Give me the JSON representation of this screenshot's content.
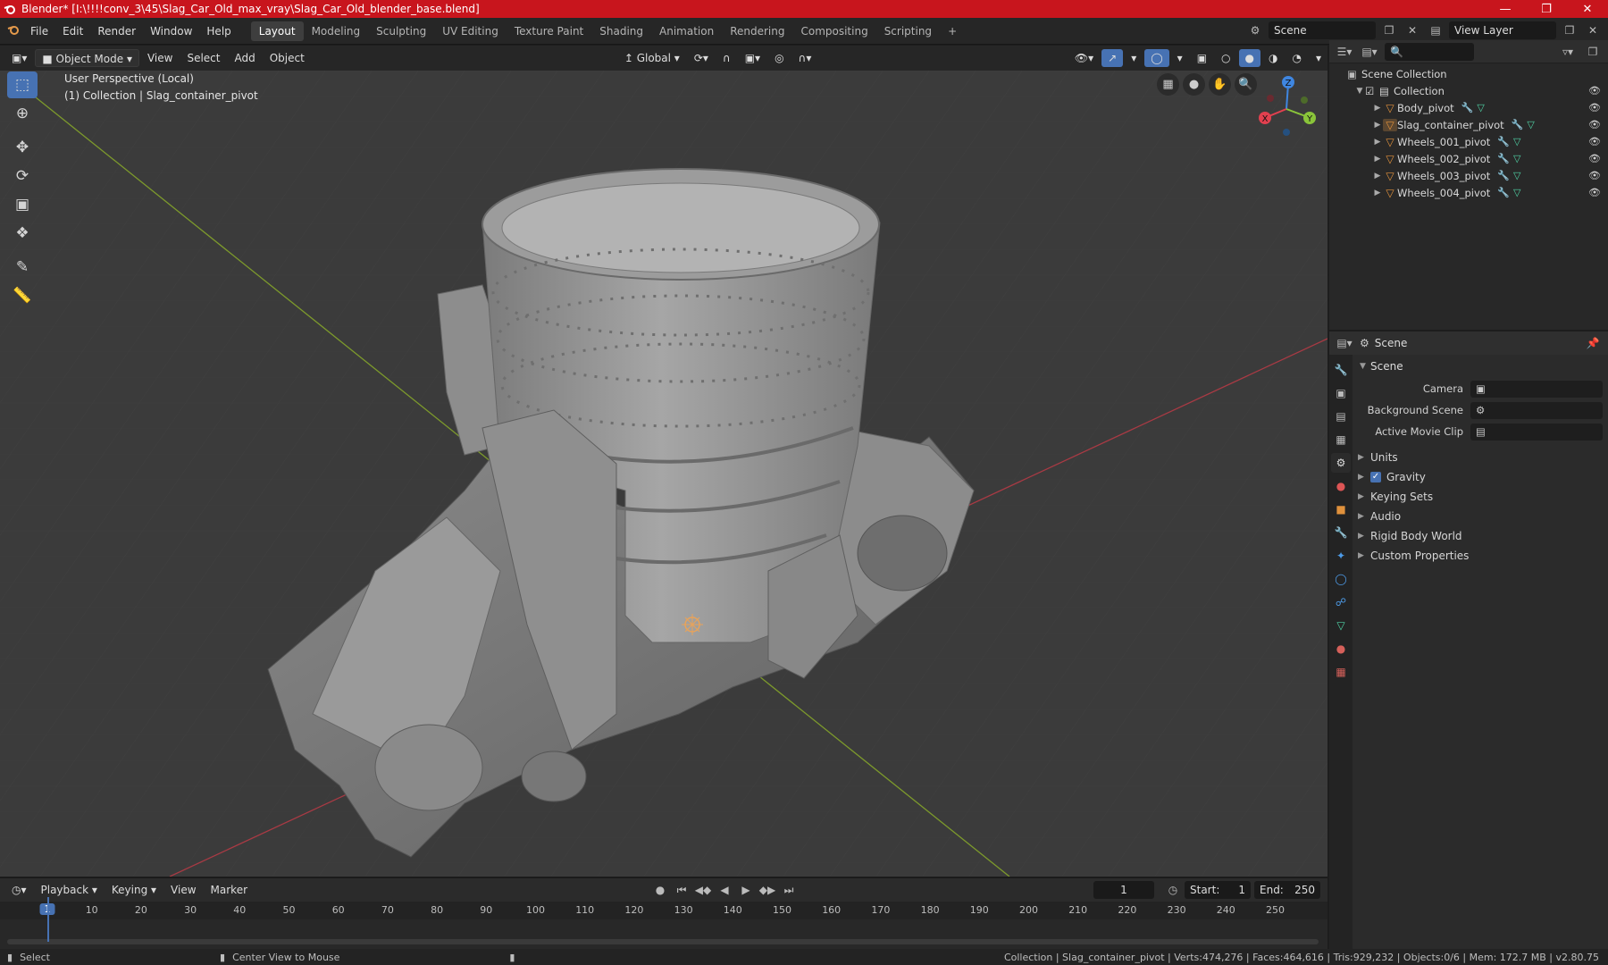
{
  "window": {
    "title": "Blender* [I:\\!!!!conv_3\\45\\Slag_Car_Old_max_vray\\Slag_Car_Old_blender_base.blend]"
  },
  "menu": [
    "File",
    "Edit",
    "Render",
    "Window",
    "Help"
  ],
  "workspaces": [
    "Layout",
    "Modeling",
    "Sculpting",
    "UV Editing",
    "Texture Paint",
    "Shading",
    "Animation",
    "Rendering",
    "Compositing",
    "Scripting"
  ],
  "active_workspace": "Layout",
  "scene_name": "Scene",
  "view_layer": "View Layer",
  "viewport": {
    "mode": "Object Mode",
    "menus": [
      "View",
      "Select",
      "Add",
      "Object"
    ],
    "transform_orientation": "Global",
    "info_line1": "User Perspective (Local)",
    "info_line2": "(1) Collection | Slag_container_pivot"
  },
  "gizmo": {
    "x": "X",
    "y": "Y",
    "z": "Z"
  },
  "outliner": {
    "root": "Scene Collection",
    "collection": "Collection",
    "objects": [
      "Body_pivot",
      "Slag_container_pivot",
      "Wheels_001_pivot",
      "Wheels_002_pivot",
      "Wheels_003_pivot",
      "Wheels_004_pivot"
    ],
    "selected": "Slag_container_pivot"
  },
  "properties": {
    "context": "Scene",
    "panel": "Scene",
    "fields": [
      {
        "label": "Camera"
      },
      {
        "label": "Background Scene"
      },
      {
        "label": "Active Movie Clip"
      }
    ],
    "subpanels": [
      "Units",
      "Gravity",
      "Keying Sets",
      "Audio",
      "Rigid Body World",
      "Custom Properties"
    ]
  },
  "timeline": {
    "menus": [
      "Playback",
      "Keying",
      "View",
      "Marker"
    ],
    "current_frame": "1",
    "start_label": "Start:",
    "start": "1",
    "end_label": "End:",
    "end": "250",
    "ticks": [
      "10",
      "20",
      "30",
      "40",
      "50",
      "60",
      "70",
      "80",
      "90",
      "100",
      "110",
      "120",
      "130",
      "140",
      "150",
      "160",
      "170",
      "180",
      "190",
      "200",
      "210",
      "220",
      "230",
      "240",
      "250"
    ]
  },
  "status": {
    "left1": "Select",
    "left2": "Center View to Mouse",
    "right": "Collection | Slag_container_pivot | Verts:474,276 | Faces:464,616 | Tris:929,232 | Objects:0/6 | Mem: 172.7 MB | v2.80.75"
  },
  "colors": {
    "title_bar": "#c8151d",
    "accent": "#4772b3",
    "object_icon": "#e0913c",
    "x_axis": "#e2404f",
    "y_axis": "#8ac43a",
    "z_axis": "#3f86e0"
  }
}
